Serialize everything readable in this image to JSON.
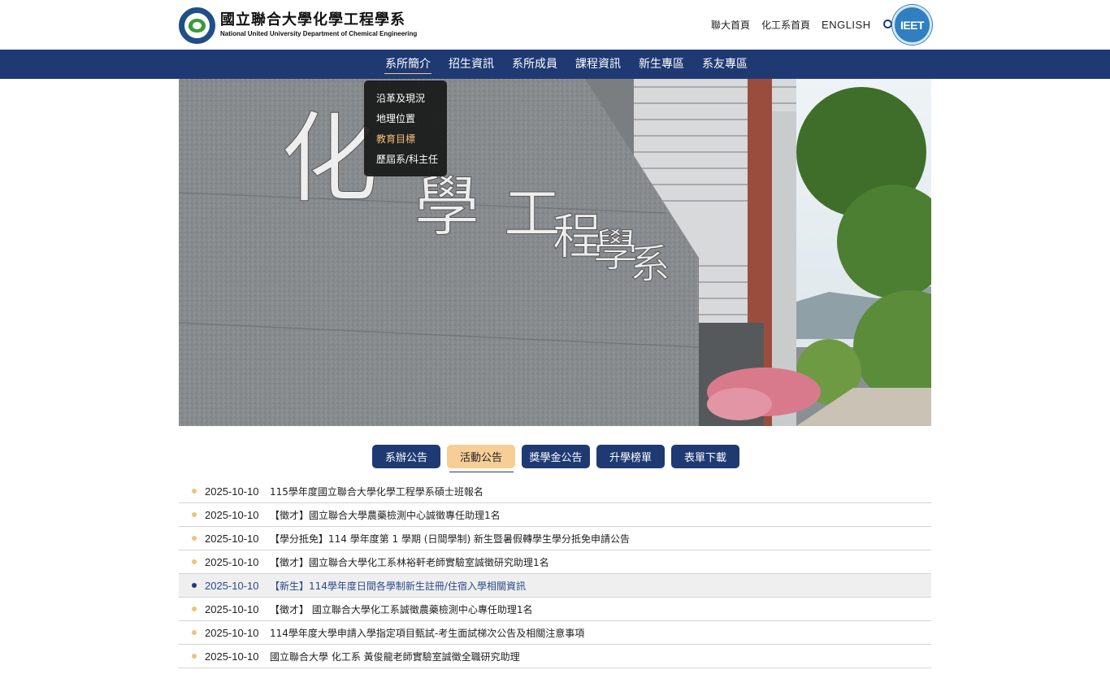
{
  "header": {
    "logo_zh": "國立聯合大學化學工程學系",
    "logo_en": "National United University Department of Chemical Engineering",
    "links": [
      "聯大首頁",
      "化工系首頁",
      "ENGLISH"
    ],
    "badge": "IEET"
  },
  "nav": {
    "items": [
      "系所簡介",
      "招生資訊",
      "系所成員",
      "課程資訊",
      "新生專區",
      "系友專區"
    ],
    "active_index": 0,
    "dropdown": [
      "沿革及現況",
      "地理位置",
      "教育目標",
      "歷屆系/科主任"
    ],
    "dropdown_highlight_index": 2
  },
  "hero": {
    "wall_text": [
      "化",
      "學",
      "工",
      "程",
      "學",
      "系"
    ]
  },
  "tabs": {
    "items": [
      "系辦公告",
      "活動公告",
      "獎學金公告",
      "升學榜單",
      "表單下載"
    ],
    "active_index": 1
  },
  "news": [
    {
      "date": "2025-10-10",
      "title": "115學年度國立聯合大學化學工程學系碩士班報名"
    },
    {
      "date": "2025-10-10",
      "title": "【徵才】國立聯合大學農藥檢測中心誠徵專任助理1名"
    },
    {
      "date": "2025-10-10",
      "title": "【學分抵免】114 學年度第 1 學期 (日間學制) 新生暨暑假轉學生學分抵免申請公告"
    },
    {
      "date": "2025-10-10",
      "title": "【徵才】國立聯合大學化工系林裕軒老師實驗室誠徵研究助理1名"
    },
    {
      "date": "2025-10-10",
      "title": "【新生】114學年度日間各學制新生註冊/住宿入學相關資訊"
    },
    {
      "date": "2025-10-10",
      "title": "【徵才】 國立聯合大學化工系誠徵農藥檢測中心專任助理1名"
    },
    {
      "date": "2025-10-10",
      "title": "114學年度大學申請入學指定項目甄試-考生面試梯次公告及相關注意事項"
    },
    {
      "date": "2025-10-10",
      "title": "國立聯合大學 化工系 黃俊龍老師實驗室誠徵全職研究助理"
    }
  ],
  "news_hover_index": 4,
  "colors": {
    "navy": "#1f3a73",
    "accent": "#f6ce96",
    "dot": "#f0c27a"
  }
}
